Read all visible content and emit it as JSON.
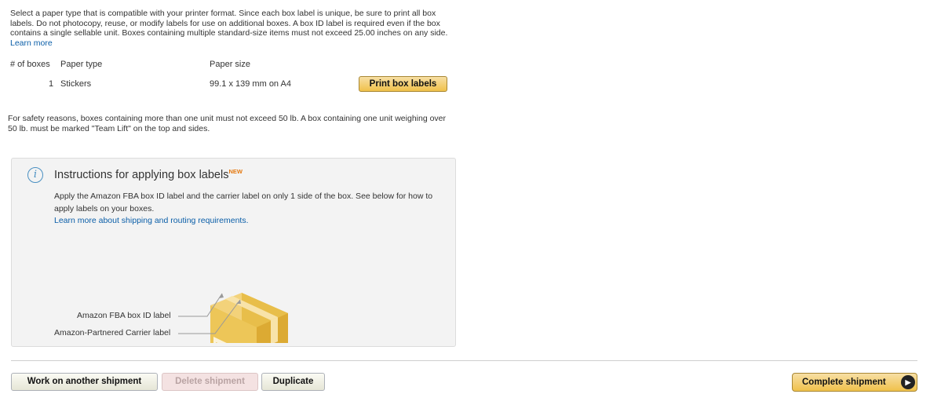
{
  "intro": {
    "text": "Select a paper type that is compatible with your printer format. Since each box label is unique, be sure to print all box labels. Do not photocopy, reuse, or modify labels for use on additional boxes. A box ID label is required even if the box contains a single sellable unit. Boxes containing multiple standard-size items must not exceed 25.00 inches on any side.",
    "learn_more": "Learn more"
  },
  "table": {
    "headers": [
      "# of boxes",
      "Paper type",
      "Paper size"
    ],
    "row": {
      "boxes": "1",
      "paper_type": "Stickers",
      "paper_size": "99.1 x 139 mm on A4"
    },
    "print_button": "Print box labels"
  },
  "safety_text": "For safety reasons, boxes containing more than one unit must not exceed 50 lb. A box containing one unit weighing over 50 lb. must be marked \"Team Lift\" on the top and sides.",
  "instructions": {
    "icon": "info-icon",
    "title": "Instructions for applying box labels",
    "badge": "NEW",
    "text": "Apply the Amazon FBA box ID label and the carrier label on only 1 side of the box. See below for how to apply labels on your boxes.",
    "link": "Learn more about shipping and routing requirements.",
    "label_fba": "Amazon FBA box ID label",
    "label_carrier": "Amazon-Partnered Carrier label"
  },
  "footer": {
    "work_on_another": "Work on another shipment",
    "delete": "Delete shipment",
    "duplicate": "Duplicate",
    "complete": "Complete shipment"
  },
  "colors": {
    "accent": "#f0c14b",
    "link": "#0a5ea8",
    "box": "#e8be4a"
  }
}
